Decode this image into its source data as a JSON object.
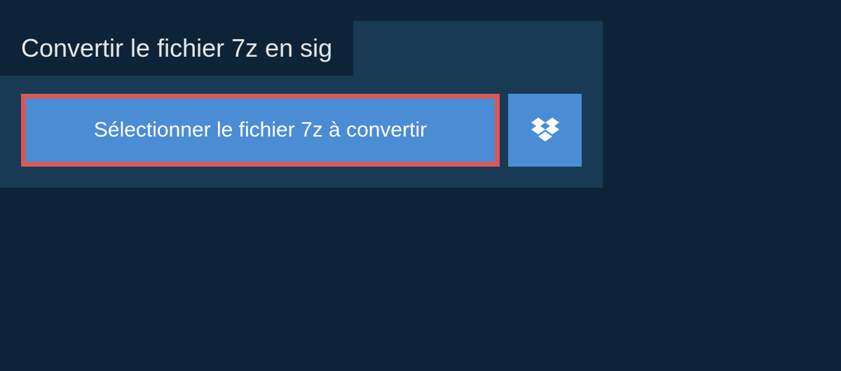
{
  "title": "Convertir le fichier 7z en sig",
  "select_button_label": "Sélectionner le fichier 7z à convertir"
}
